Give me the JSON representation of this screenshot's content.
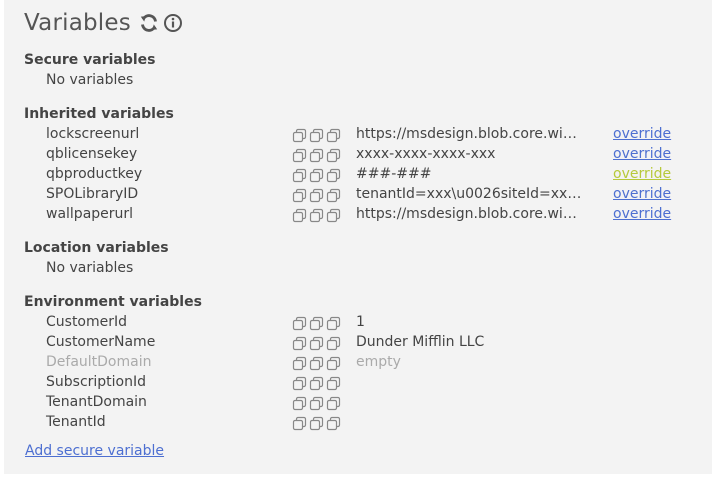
{
  "title": "Variables",
  "icons": {
    "refresh": "refresh-icon",
    "info": "info-icon",
    "copy": "copy-icon"
  },
  "colors": {
    "link": "#4d6fd1",
    "link_highlight": "#b7c93a",
    "muted_text": "#aaaaaa",
    "panel_bg": "#f3f3f3"
  },
  "secure": {
    "heading": "Secure variables",
    "empty": "No variables"
  },
  "inherited": {
    "heading": "Inherited variables",
    "rows": [
      {
        "name": "lockscreenurl",
        "value": "https://msdesign.blob.core.wind…",
        "action": "override"
      },
      {
        "name": "qblicensekey",
        "value": "xxxx-xxxx-xxxx-xxx",
        "action": "override"
      },
      {
        "name": "qbproductkey",
        "value": "###-###",
        "action": "override"
      },
      {
        "name": "SPOLibraryID",
        "value": "tenantId=xxx\\u0026siteId=xxx\\u…",
        "action": "override"
      },
      {
        "name": "wallpaperurl",
        "value": "https://msdesign.blob.core.wind…",
        "action": "override"
      }
    ]
  },
  "location": {
    "heading": "Location variables",
    "empty": "No variables"
  },
  "environment": {
    "heading": "Environment variables",
    "rows": [
      {
        "name": "CustomerId",
        "value": "1"
      },
      {
        "name": "CustomerName",
        "value": "Dunder Mifflin LLC"
      },
      {
        "name": "DefaultDomain",
        "value": "empty"
      },
      {
        "name": "SubscriptionId",
        "value": ""
      },
      {
        "name": "TenantDomain",
        "value": ""
      },
      {
        "name": "TenantId",
        "value": ""
      }
    ]
  },
  "add_secure_label": "Add secure variable"
}
